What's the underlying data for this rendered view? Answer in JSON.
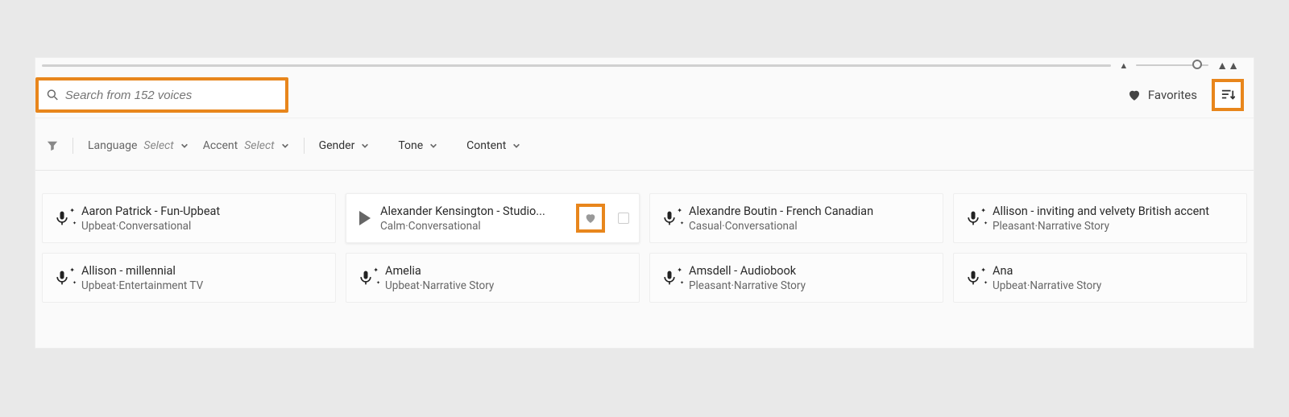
{
  "search": {
    "placeholder": "Search from 152 voices"
  },
  "favorites_label": "Favorites",
  "filters": {
    "language_label": "Language",
    "language_value": "Select",
    "accent_label": "Accent",
    "accent_value": "Select",
    "gender_label": "Gender",
    "tone_label": "Tone",
    "content_label": "Content"
  },
  "voices": [
    {
      "title": "Aaron Patrick - Fun-Upbeat",
      "sub": "Upbeat·Conversational"
    },
    {
      "title": "Alexander Kensington - Studio...",
      "sub": "Calm·Conversational"
    },
    {
      "title": "Alexandre Boutin - French Canadian",
      "sub": "Casual·Conversational"
    },
    {
      "title": "Allison - inviting and velvety British accent",
      "sub": "Pleasant·Narrative Story"
    },
    {
      "title": "Allison - millennial",
      "sub": "Upbeat·Entertainment TV"
    },
    {
      "title": "Amelia",
      "sub": "Upbeat·Narrative Story"
    },
    {
      "title": "Amsdell - Audiobook",
      "sub": "Pleasant·Narrative Story"
    },
    {
      "title": "Ana",
      "sub": "Upbeat·Narrative Story"
    }
  ]
}
